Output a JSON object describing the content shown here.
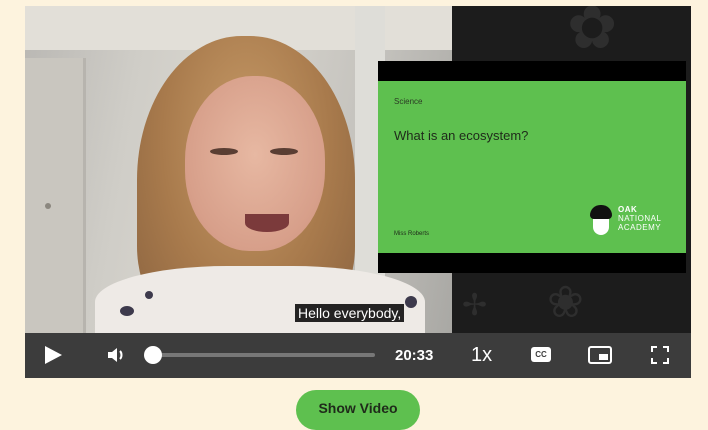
{
  "video": {
    "caption": "Hello everybody,",
    "slide": {
      "subject": "Science",
      "title": "What is an ecosystem?",
      "author": "Miss Roberts",
      "logo_line1": "OAK",
      "logo_line2": "NATIONAL",
      "logo_line3": "ACADEMY"
    }
  },
  "controls": {
    "time": "20:33",
    "speed": "1x",
    "cc_label": "CC",
    "progress": 0.0
  },
  "show_video_button": "Show Video",
  "colors": {
    "page_bg": "#fdf3de",
    "accent_green": "#5ec04f",
    "control_bar": "#3c3c3c"
  }
}
